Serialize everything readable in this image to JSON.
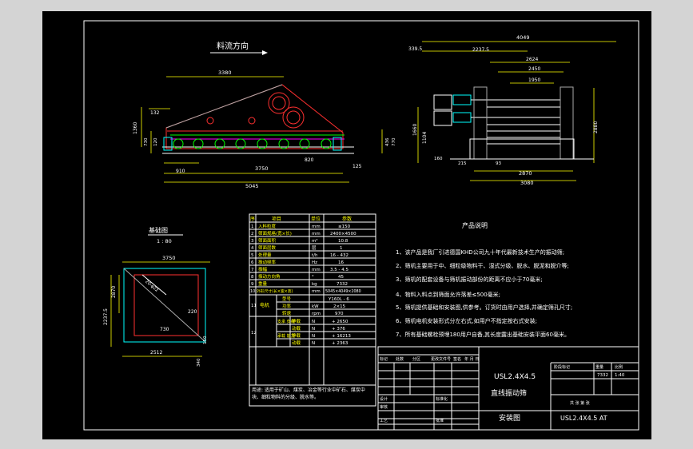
{
  "side_view": {
    "title": "料流方向",
    "dims": [
      "3380",
      "132",
      "1360",
      "730",
      "120",
      "910",
      "3750",
      "820",
      "125",
      "5045",
      "436",
      "770"
    ]
  },
  "end_view": {
    "dims": [
      "4049",
      "339.5",
      "2237.5",
      "2624",
      "2450",
      "1950",
      "1660",
      "1104",
      "2880",
      "160",
      "215",
      "93",
      "2870",
      "3080"
    ]
  },
  "foundation": {
    "title": "基础图",
    "scale": "1 : 80",
    "dims": [
      "3750",
      "20-φ22",
      "2870",
      "2237.5",
      "220",
      "730",
      "150",
      "2512",
      "340"
    ]
  },
  "params": {
    "headers": [
      "序",
      "项目",
      "单位",
      "参数"
    ],
    "rows": [
      [
        "1",
        "入料粒度",
        "mm",
        "≤150"
      ],
      [
        "2",
        "筛面规格(宽×长)",
        "mm",
        "2400×4500"
      ],
      [
        "3",
        "筛面面积",
        "m²",
        "10.8"
      ],
      [
        "4",
        "筛面层数",
        "层",
        "1"
      ],
      [
        "5",
        "处理量",
        "t/h",
        "16 - 432"
      ],
      [
        "6",
        "振动频率",
        "Hz",
        "16"
      ],
      [
        "7",
        "振幅",
        "mm",
        "3.5 - 4.5"
      ],
      [
        "8",
        "振动方向角",
        "°",
        "45"
      ],
      [
        "9",
        "重量",
        "kg",
        "7332"
      ],
      [
        "10",
        "外形尺寸(长×宽×高)",
        "mm",
        "5045×4049×2080"
      ]
    ],
    "motor_label": "电机",
    "motor_rows": [
      [
        "型号",
        "",
        "Y160L - 6"
      ],
      [
        "功率",
        "kW",
        "2×15"
      ],
      [
        "转速",
        "rpm",
        "970"
      ]
    ],
    "row_11": "11",
    "row_12": "12",
    "load_rows": [
      [
        "支承\n负荷",
        "静载",
        "N",
        "+ 2650"
      ],
      [
        "",
        "动载",
        "N",
        "+ 376"
      ],
      [
        "承载\n能力",
        "静载",
        "N",
        "+ 16213"
      ],
      [
        "",
        "动载",
        "N",
        "+ 2363"
      ]
    ],
    "usage": "用途: 适用于矿山、煤炭、冶金等行业中矿石、煤炭中块、细粒物料的分级、脱水等。"
  },
  "notes": {
    "title": "产品说明",
    "items": [
      "1、该产品是我厂引进德国KHD公司九十年代最新技术生产的振动筛;",
      "2、筛机主要用于中、细粒级物料干、湿式分级、脱水、脱泥和脱介等;",
      "3、筛机的配套设备与筛机振动部份的距离不应小于70毫米;",
      "4、物料入料点到筛面允许落差≤500毫米;",
      "5、筛机提供基础和安装图,供参考。订货时由用户选择,并确定筛孔尺寸;",
      "6、筛机电机安装形式分左右式,如用户不指定按右式安装;",
      "7、所有基础螺栓预埋180用户自备,其长度露出基础安装平面60毫米。"
    ]
  },
  "title_block": {
    "model": "USL2.4X4.5",
    "name": "直线振动筛",
    "drawing": "安装图",
    "code": "USL2.4X4.5 AT",
    "weight": "7332",
    "scale": "1:40",
    "weight_label": "重量",
    "scale_label": "比例",
    "labels": [
      "标记",
      "处数",
      "分区",
      "更改文件号",
      "签名",
      "年 月 日",
      "设计",
      "标准化",
      "阶段标记",
      "审核",
      "工艺",
      "批准"
    ],
    "sheet_text": "共 张  第 张"
  }
}
